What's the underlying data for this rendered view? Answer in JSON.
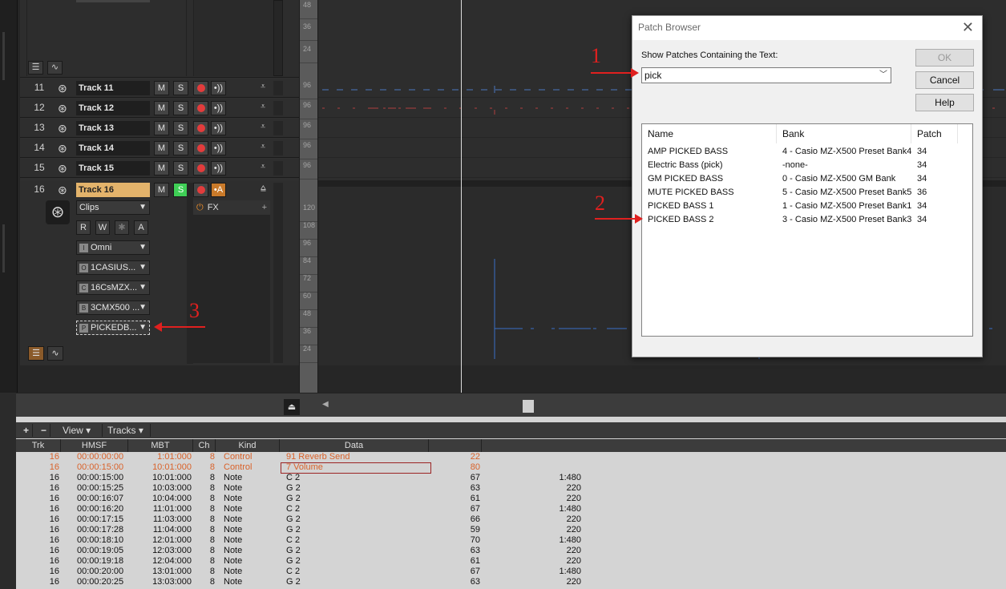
{
  "tracks": [
    {
      "num": "11",
      "name": "Track 11",
      "m": "M",
      "s": "S"
    },
    {
      "num": "12",
      "name": "Track 12",
      "m": "M",
      "s": "S"
    },
    {
      "num": "13",
      "name": "Track 13",
      "m": "M",
      "s": "S"
    },
    {
      "num": "14",
      "name": "Track 14",
      "m": "M",
      "s": "S"
    },
    {
      "num": "15",
      "name": "Track 15",
      "m": "M",
      "s": "S"
    }
  ],
  "track16": {
    "num": "16",
    "name": "Track 16",
    "m": "M",
    "s": "S",
    "clips": "Clips",
    "r": "R",
    "w": "W",
    "star": "✱",
    "a": "A",
    "input": "Omni",
    "input_prefix": "I",
    "output": "1CASIUS...",
    "output_prefix": "O",
    "channel": "16CsMZX...",
    "channel_prefix": "C",
    "bank": "3CMX500 ...",
    "bank_prefix": "B",
    "patch": "PICKEDB...",
    "patch_prefix": "P",
    "fx": "FX"
  },
  "ruler_top": [
    "48",
    "36",
    "24"
  ],
  "ruler_rows": [
    "96",
    "96",
    "96",
    "96",
    "96"
  ],
  "ruler_big": [
    "120",
    "108",
    "96",
    "84",
    "72",
    "60",
    "48",
    "36",
    "24"
  ],
  "dialog": {
    "title": "Patch Browser",
    "label": "Show Patches Containing the Text:",
    "filter": "pick",
    "ok": "OK",
    "cancel": "Cancel",
    "help": "Help",
    "columns": [
      "Name",
      "Bank",
      "Patch"
    ],
    "rows": [
      {
        "name": "AMP PICKED BASS",
        "bank": "4 - Casio MZ-X500 Preset Bank4",
        "patch": "34"
      },
      {
        "name": "Electric Bass (pick)",
        "bank": "-none-",
        "patch": "34"
      },
      {
        "name": "GM PICKED BASS",
        "bank": "0 - Casio MZ-X500 GM Bank",
        "patch": "34"
      },
      {
        "name": "MUTE PICKED BASS",
        "bank": "5 - Casio MZ-X500 Preset Bank5",
        "patch": "36"
      },
      {
        "name": "PICKED BASS 1",
        "bank": "1 - Casio MZ-X500 Preset Bank1",
        "patch": "34"
      },
      {
        "name": "PICKED BASS 2",
        "bank": "3 - Casio MZ-X500 Preset Bank3",
        "patch": "34"
      }
    ]
  },
  "annotations": [
    "1",
    "2",
    "3"
  ],
  "event_toolbar": {
    "plus": "+",
    "minus": "−",
    "view": "View",
    "tracks": "Tracks"
  },
  "event_columns": [
    "Trk",
    "HMSF",
    "MBT",
    "Ch",
    "Kind",
    "Data"
  ],
  "events": [
    {
      "trk": "16",
      "hmsf": "00:00:00:00",
      "mbt": "1:01:000",
      "ch": "8",
      "kind": "Control",
      "d1": "91 Reverb Send",
      "d2": "22",
      "d3": "",
      "ctl": true
    },
    {
      "trk": "16",
      "hmsf": "00:00:15:00",
      "mbt": "10:01:000",
      "ch": "8",
      "kind": "Control",
      "d1": "7 Volume",
      "d2": "80",
      "d3": "",
      "ctl": true
    },
    {
      "trk": "16",
      "hmsf": "00:00:15:00",
      "mbt": "10:01:000",
      "ch": "8",
      "kind": "Note",
      "d1": "C 2",
      "d2": "67",
      "d3": "1:480"
    },
    {
      "trk": "16",
      "hmsf": "00:00:15:25",
      "mbt": "10:03:000",
      "ch": "8",
      "kind": "Note",
      "d1": "G 2",
      "d2": "63",
      "d3": "220"
    },
    {
      "trk": "16",
      "hmsf": "00:00:16:07",
      "mbt": "10:04:000",
      "ch": "8",
      "kind": "Note",
      "d1": "G 2",
      "d2": "61",
      "d3": "220"
    },
    {
      "trk": "16",
      "hmsf": "00:00:16:20",
      "mbt": "11:01:000",
      "ch": "8",
      "kind": "Note",
      "d1": "C 2",
      "d2": "67",
      "d3": "1:480"
    },
    {
      "trk": "16",
      "hmsf": "00:00:17:15",
      "mbt": "11:03:000",
      "ch": "8",
      "kind": "Note",
      "d1": "G 2",
      "d2": "66",
      "d3": "220"
    },
    {
      "trk": "16",
      "hmsf": "00:00:17:28",
      "mbt": "11:04:000",
      "ch": "8",
      "kind": "Note",
      "d1": "G 2",
      "d2": "59",
      "d3": "220"
    },
    {
      "trk": "16",
      "hmsf": "00:00:18:10",
      "mbt": "12:01:000",
      "ch": "8",
      "kind": "Note",
      "d1": "C 2",
      "d2": "70",
      "d3": "1:480"
    },
    {
      "trk": "16",
      "hmsf": "00:00:19:05",
      "mbt": "12:03:000",
      "ch": "8",
      "kind": "Note",
      "d1": "G 2",
      "d2": "63",
      "d3": "220"
    },
    {
      "trk": "16",
      "hmsf": "00:00:19:18",
      "mbt": "12:04:000",
      "ch": "8",
      "kind": "Note",
      "d1": "G 2",
      "d2": "61",
      "d3": "220"
    },
    {
      "trk": "16",
      "hmsf": "00:00:20:00",
      "mbt": "13:01:000",
      "ch": "8",
      "kind": "Note",
      "d1": "C 2",
      "d2": "67",
      "d3": "1:480"
    },
    {
      "trk": "16",
      "hmsf": "00:00:20:25",
      "mbt": "13:03:000",
      "ch": "8",
      "kind": "Note",
      "d1": "G 2",
      "d2": "63",
      "d3": "220"
    }
  ]
}
